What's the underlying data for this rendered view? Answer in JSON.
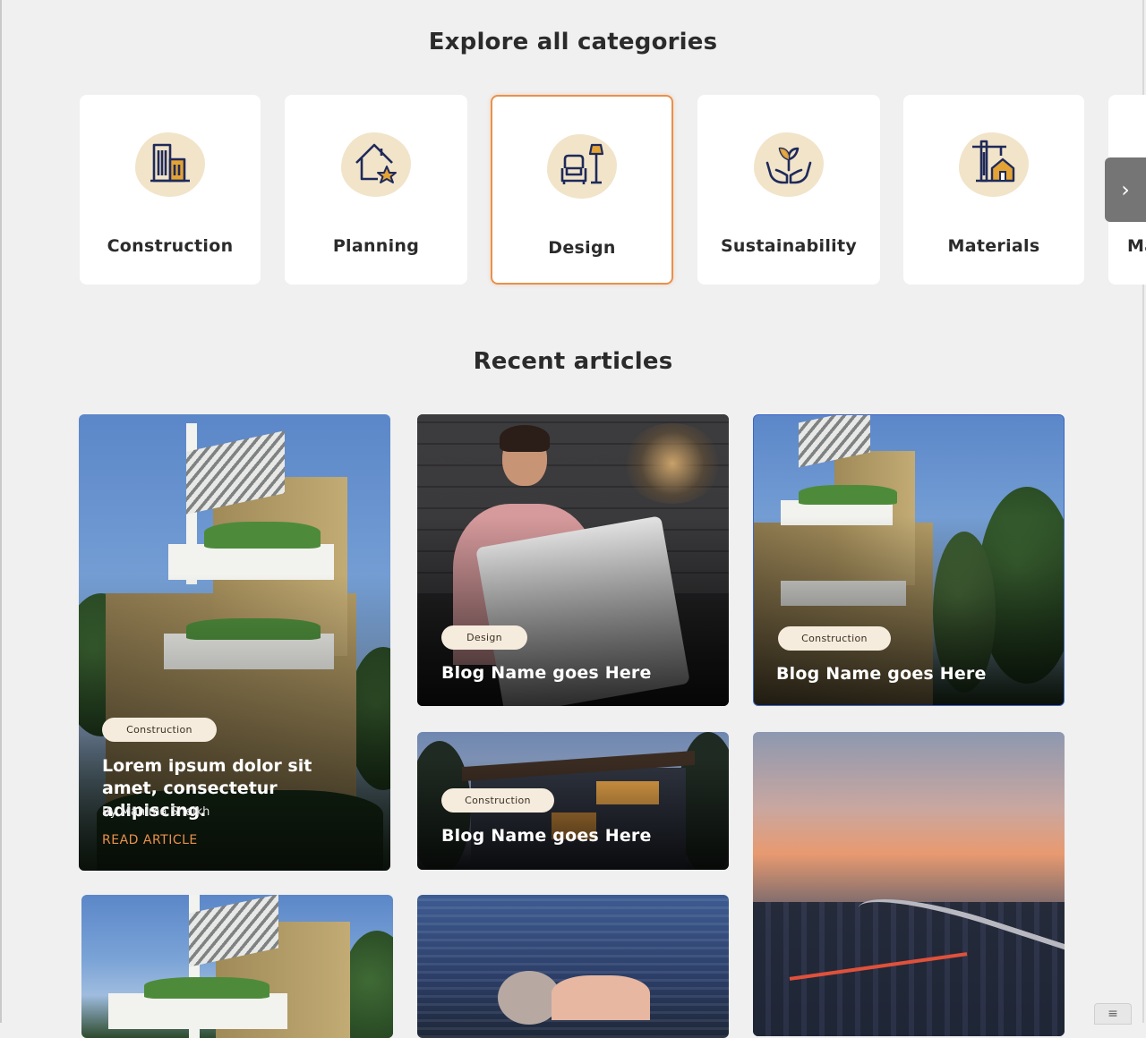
{
  "categories_section": {
    "title": "Explore all categories"
  },
  "categories": [
    {
      "label": "Construction",
      "icon": "buildings-icon",
      "selected": false
    },
    {
      "label": "Planning",
      "icon": "house-star-icon",
      "selected": false
    },
    {
      "label": "Design",
      "icon": "armchair-lamp-icon",
      "selected": true
    },
    {
      "label": "Sustainability",
      "icon": "hands-plant-icon",
      "selected": false
    },
    {
      "label": "Materials",
      "icon": "crane-house-icon",
      "selected": false
    },
    {
      "label": "Ma",
      "icon": "",
      "selected": false
    }
  ],
  "carousel": {
    "next_icon": "chevron-right-icon",
    "next_glyph": "›"
  },
  "articles_section": {
    "title": "Recent articles"
  },
  "featured_article": {
    "category": "Construction",
    "title": "Lorem ipsum dolor sit amet, consectetur adipiscing.",
    "author": "By Mahima Sheikh",
    "link": "READ ARTICLE"
  },
  "articles": [
    {
      "category": "Design",
      "title": "Blog Name goes Here"
    },
    {
      "category": "Construction",
      "title": "Blog Name goes Here"
    },
    {
      "category": "Construction",
      "title": "Blog Name goes Here"
    }
  ],
  "colors": {
    "accent": "#e8914d",
    "icon_navy": "#1f2a5a",
    "icon_gold": "#e3a335",
    "blob": "#f1e4c9",
    "background": "#f0f0f0"
  }
}
